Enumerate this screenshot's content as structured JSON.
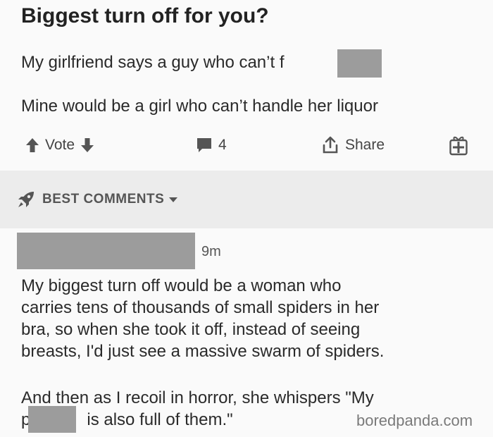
{
  "post": {
    "title": "Biggest turn off for you?",
    "body_line1": "My girlfriend says a guy who can’t f",
    "body_line2": "Mine would be a girl who can’t handle her liquor"
  },
  "actions": {
    "vote_label": "Vote",
    "comments_count": "4",
    "share_label": "Share"
  },
  "sort": {
    "label": "BEST COMMENTS"
  },
  "comment": {
    "time": "9m",
    "paragraph1_lines": [
      "My biggest turn off would be a woman who",
      "carries tens of thousands of small spiders in her",
      "bra, so when she took it off, instead of seeing",
      "breasts, I'd just see a massive swarm of spiders."
    ],
    "paragraph2_line1": "And then as I recoil in horror, she whispers \"My",
    "paragraph2_line2_start": "p",
    "paragraph2_line2_end": "is also full of them.\""
  },
  "watermark": "boredpanda.com",
  "icons": {
    "upvote": "arrow-up-icon",
    "downvote": "arrow-down-icon",
    "comment": "comment-bubble-icon",
    "share": "share-icon",
    "award": "gift-icon",
    "sort": "rocket-icon",
    "dropdown": "caret-down-icon"
  },
  "colors": {
    "background": "#fafafa",
    "band": "#ececec",
    "redaction": "#9c9c9c",
    "text": "#2a2a2a"
  }
}
